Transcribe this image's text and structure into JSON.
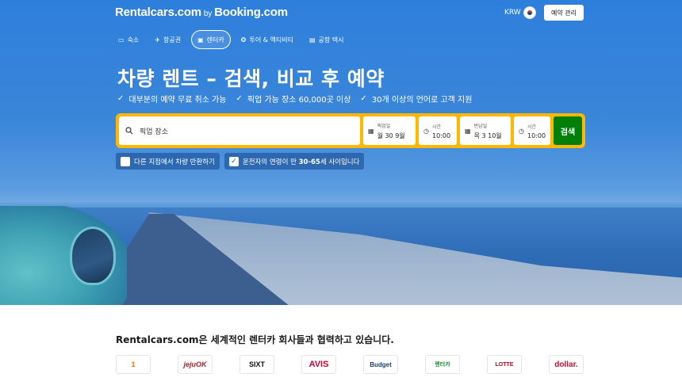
{
  "header": {
    "logo_left": "Rentalcars.com",
    "logo_by": "by",
    "logo_right": "Booking.com",
    "currency": "KRW",
    "manage_label": "예약 관리"
  },
  "nav": {
    "items": [
      {
        "icon": "bed-icon",
        "label": "숙소"
      },
      {
        "icon": "plane-icon",
        "label": "항공권"
      },
      {
        "icon": "car-icon",
        "label": "렌터카"
      },
      {
        "icon": "attractions-icon",
        "label": "투어 & 액티비티"
      },
      {
        "icon": "taxi-icon",
        "label": "공항 택시"
      }
    ]
  },
  "hero": {
    "headline": "차량 렌트 – 검색, 비교 후 예약",
    "features": [
      "대부분의 예약 무료 취소 가능",
      "픽업 가능 장소 60,000곳 이상",
      "30개 이상의 언어로 고객 지원"
    ]
  },
  "search": {
    "pickup_placeholder": "픽업 장소",
    "pickup_date_label": "픽업일",
    "pickup_date_value": "월 30 9월",
    "pickup_time_label": "시간",
    "pickup_time_value": "10:00",
    "return_date_label": "반납일",
    "return_date_value": "목 3 10월",
    "return_time_label": "시간",
    "return_time_value": "10:00",
    "button_label": "검색"
  },
  "options": {
    "diff_location": "다른 지점에서 차량 반환하기",
    "driver_age_prefix": "운전자의 연령이 만 ",
    "driver_age_range": "30-65",
    "driver_age_suffix": "세 사이입니다"
  },
  "partners": {
    "title": "Rentalcars.com은 세계적인 렌터카 회사들과 협력하고 있습니다.",
    "logos": [
      {
        "text": "1",
        "color": "#e07a10"
      },
      {
        "text": "jejuOK",
        "color": "#b51f24"
      },
      {
        "text": "SIXT",
        "color": "#111111"
      },
      {
        "text": "AVIS",
        "color": "#d4002a"
      },
      {
        "text": "Budget",
        "color": "#1a3e7d"
      },
      {
        "text": "렌터카",
        "color": "#1f8a3a"
      },
      {
        "text": "LOTTE",
        "color": "#d1001f"
      },
      {
        "text": "dollar.",
        "color": "#c8102e"
      }
    ]
  }
}
